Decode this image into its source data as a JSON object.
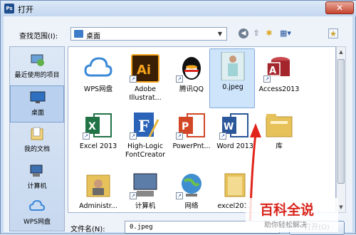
{
  "window": {
    "title": "打开",
    "app_icon": "Ps",
    "close": "✕"
  },
  "toolbar": {
    "lookin_label": "查找范围(I):",
    "lookin_value": "桌面",
    "icons": [
      "back-icon",
      "up-folder-icon",
      "new-folder-icon",
      "views-menu-icon",
      "desktop-favorite-icon"
    ]
  },
  "places": [
    {
      "label": "最近使用的项目",
      "icon": "recent-items-icon"
    },
    {
      "label": "桌面",
      "icon": "desktop-icon"
    },
    {
      "label": "我的文档",
      "icon": "documents-icon"
    },
    {
      "label": "计算机",
      "icon": "computer-icon"
    },
    {
      "label": "WPS网盘",
      "icon": "wps-cloud-icon"
    }
  ],
  "files": [
    {
      "name": "WPS网盘",
      "icon": "wps-cloud-icon",
      "color": "#3b88d6"
    },
    {
      "name": "Adobe Illustrat...",
      "icon": "illustrator-icon",
      "color": "#3a1f05"
    },
    {
      "name": "腾讯QQ",
      "icon": "qq-penguin-icon",
      "color": "#111111"
    },
    {
      "name": "0.jpeg",
      "icon": "image-thumbnail-icon",
      "color": "#9fd3d6"
    },
    {
      "name": "Access2013",
      "icon": "access-icon",
      "color": "#a4262c"
    },
    {
      "name": "Excel 2013",
      "icon": "excel-icon",
      "color": "#217346"
    },
    {
      "name": "High-Logic FontCreator",
      "icon": "fontcreator-icon",
      "color": "#2a63b8"
    },
    {
      "name": "PowerPnt...",
      "icon": "powerpoint-icon",
      "color": "#d24726"
    },
    {
      "name": "Word 2013",
      "icon": "word-icon",
      "color": "#2b579a"
    },
    {
      "name": "库",
      "icon": "library-folder-icon",
      "color": "#e7c15a"
    },
    {
      "name": "Administr...",
      "icon": "user-folder-icon",
      "color": "#e7c15a"
    },
    {
      "name": "计算机",
      "icon": "computer-icon",
      "color": "#5b7da8"
    },
    {
      "name": "网络",
      "icon": "network-globe-icon",
      "color": "#3f8fd0"
    },
    {
      "name": "excel2013",
      "icon": "folder-icon",
      "color": "#e7c15a"
    }
  ],
  "bottom": {
    "filename_label": "文件名(N):",
    "filename_value": "0.jpeg",
    "open_label": "打开(O)"
  },
  "watermark": {
    "title": "百科全说",
    "subtitle": "助你轻松解决"
  }
}
